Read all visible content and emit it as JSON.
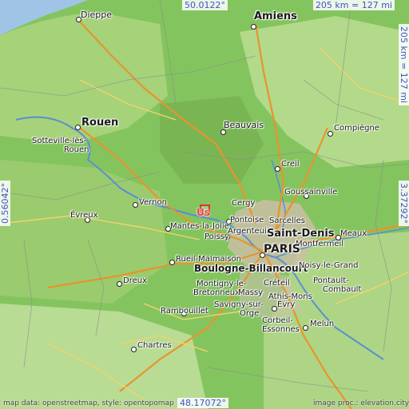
{
  "map": {
    "coords": {
      "top": "50.0122°",
      "bottom": "48.17072°",
      "left": "0.56042°",
      "right": "3.37292°"
    },
    "scale": {
      "horizontal": "205 km = 127 mi",
      "vertical": "205 km = 127 mi"
    },
    "marker_label": "Us",
    "attribution_left": "map data: openstreetmap, style: opentopomap",
    "attribution_right": "image proc.: elevation.city",
    "cities": {
      "dieppe": "Dieppe",
      "amiens": "Amiens",
      "rouen": "Rouen",
      "sotteville": "Sotteville-lès-",
      "sotteville2": "Rouen",
      "beauvais": "Beauvais",
      "compiegne": "Compiègne",
      "creil": "Creil",
      "cergy": "Cergy",
      "pontoise": "Pontoise",
      "goussainville": "Goussainville",
      "sarcelles": "Sarcelles",
      "vernon": "Vernon",
      "evreux": "Évreux",
      "mantes": "Mantes-la-Jolie",
      "argenteuil": "Argenteuil",
      "poissy": "Poissy",
      "saintdenis": "Saint-Denis",
      "montfermeil": "Montfermeil",
      "meaux": "Meaux",
      "paris": "PARIS",
      "rueil": "Rueil-Malmaison",
      "boulogne": "Boulogne-Billancourt",
      "noisy": "Noisy-le-Grand",
      "dreux": "Dreux",
      "creteil": "Créteil",
      "pontault": "Pontault-",
      "combault": "Combault",
      "montigny1": "Montigny-le-",
      "montigny2": "Bretonneux",
      "massy": "Massy",
      "athis": "Athis-Mons",
      "rambouillet": "Rambouillet",
      "savigny1": "Savigny-sur-",
      "savigny2": "Orge",
      "evry": "Évry",
      "corbeil1": "Corbeil-",
      "corbeil2": "Essonnes",
      "melun": "Melun",
      "chartres": "Chartres"
    }
  }
}
